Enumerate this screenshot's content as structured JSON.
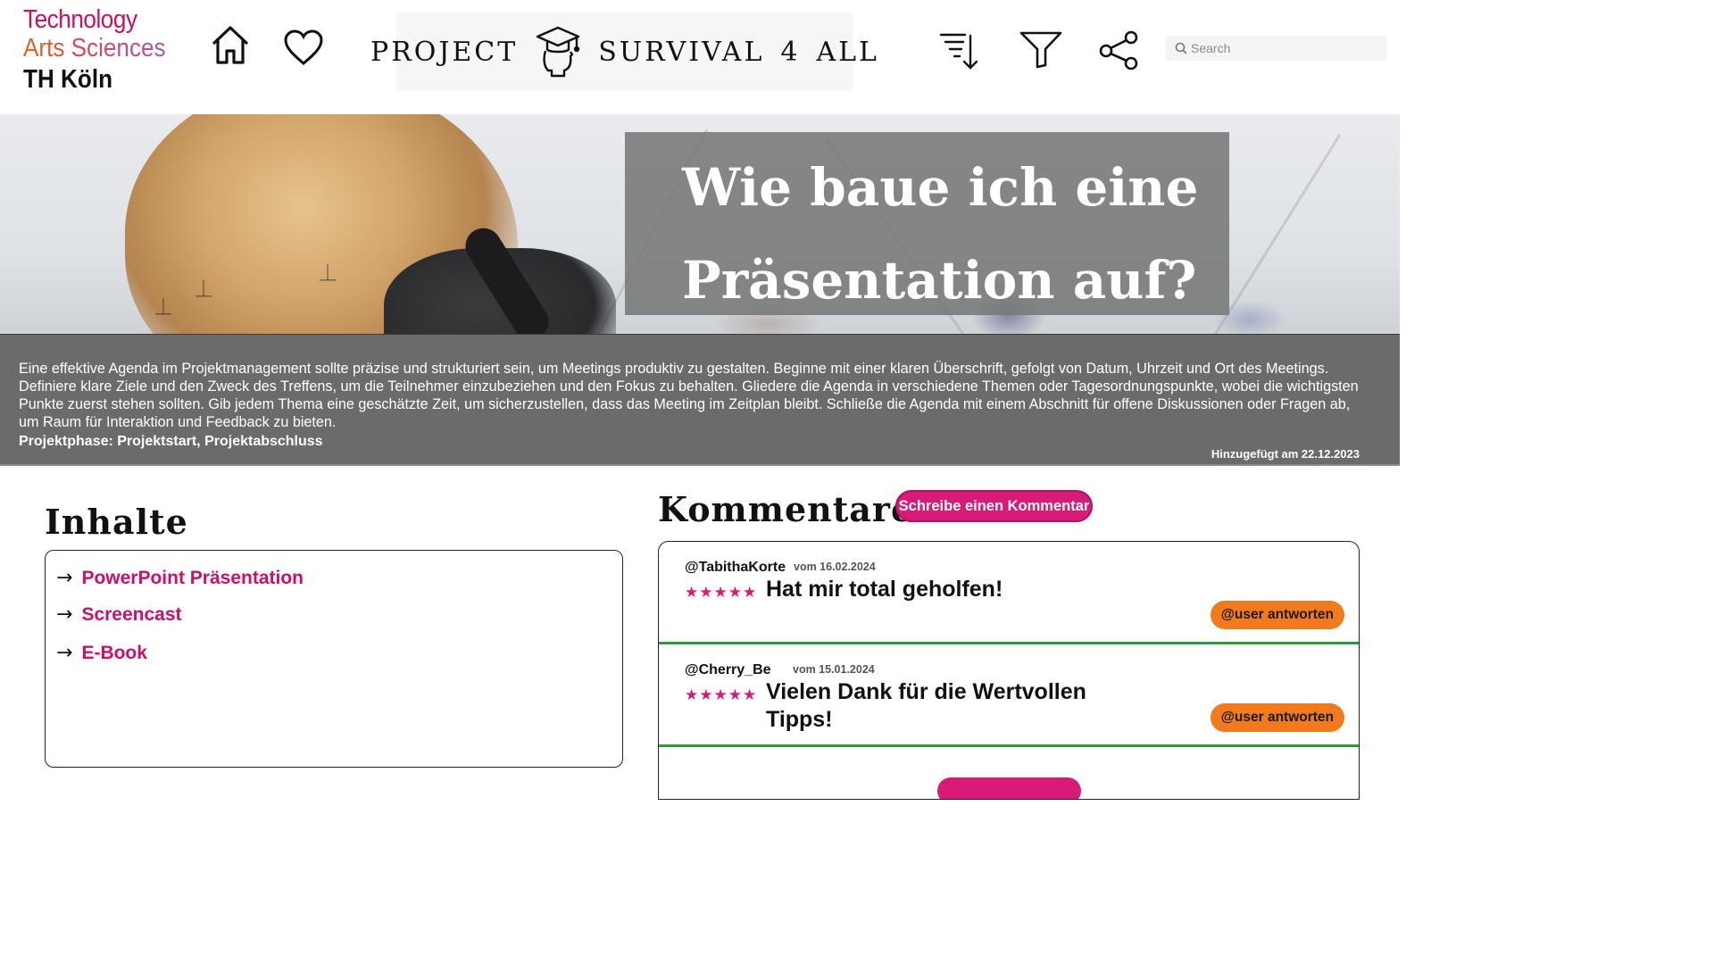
{
  "header": {
    "logo": {
      "line1": "Technology",
      "line2": "Arts Sciences",
      "line3": "TH Köln"
    },
    "nav_icons": [
      "home-icon",
      "heart-icon"
    ],
    "brand": {
      "word1": "PROJECT",
      "word2": "SURVIVAL",
      "word3": "4",
      "word4": "ALL",
      "icon": "graduate-head-icon"
    },
    "tool_icons": [
      "sort-descending-icon",
      "filter-icon",
      "share-icon"
    ],
    "search": {
      "placeholder": "Search",
      "value": ""
    }
  },
  "hero": {
    "title": "Wie baue ich eine Präsentation auf?"
  },
  "description": {
    "text": "Eine effektive Agenda im Projektmanagement sollte präzise und strukturiert sein, um Meetings produktiv zu gestalten. Beginne mit einer klaren Überschrift, gefolgt von Datum, Uhrzeit und Ort des Meetings. Definiere klare Ziele und den Zweck des Treffens, um die Teilnehmer einzubeziehen und den Fokus zu behalten. Gliedere die Agenda in verschiedene Themen oder Tagesordnungspunkte, wobei die wichtigsten Punkte zuerst stehen sollten. Gib jedem Thema eine geschätzte Zeit, um sicherzustellen, dass das Meeting im Zeitplan bleibt. Schließe die Agenda mit einem Abschnitt für offene Diskussionen oder Fragen ab, um Raum für Interaktion und Feedback zu bieten.",
    "phase": "Projektphase: Projektstart, Projektabschluss",
    "added": "Hinzugefügt am 22.12.2023"
  },
  "contents": {
    "title": "Inhalte",
    "items": [
      {
        "arrow": "→",
        "label": "PowerPoint Präsentation"
      },
      {
        "arrow": "→",
        "label": "Screencast"
      },
      {
        "arrow": "→",
        "label": "E-Book"
      }
    ]
  },
  "comments": {
    "title": "Kommentare",
    "write_button": "Schreibe einen Kommentar",
    "items": [
      {
        "user": "@TabithaKorte",
        "date": "vom 16.02.2024",
        "rating": 5,
        "stars": "★★★★★",
        "text": "Hat mir total geholfen!",
        "reply": "@user antworten"
      },
      {
        "user": "@Cherry_Be",
        "date": "vom 15.01.2024",
        "rating": 5,
        "stars": "★★★★★",
        "text": "Vielen Dank für die Wertvollen Tipps!",
        "reply": "@user antworten"
      }
    ]
  },
  "colors": {
    "accent_pink": "#d81b78",
    "reply_orange": "#f07a1c",
    "divider_green": "#2a9a3a",
    "desc_gray": "#6b6b6b"
  }
}
